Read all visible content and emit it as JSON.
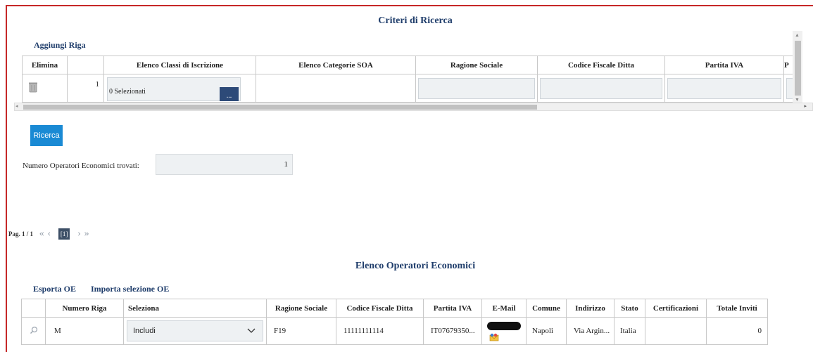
{
  "criteria": {
    "title": "Criteri di Ricerca",
    "add_row": "Aggiungi Riga",
    "columns": [
      "Elimina",
      "",
      "Elenco Classi di Iscrizione",
      "Elenco Categorie SOA",
      "Ragione Sociale",
      "Codice Fiscale Ditta",
      "Partita IVA",
      "P"
    ],
    "row": {
      "number": "1",
      "classi_value": "0 Selezionati",
      "picker_label": "..."
    }
  },
  "search": {
    "button": "Ricerca",
    "found_label": "Numero Operatori Economici trovati:",
    "found_value": "1"
  },
  "pager": {
    "label": "Pag. 1 / 1",
    "first": "«",
    "prev": "‹",
    "current": "[1]",
    "next": "›",
    "last": "»"
  },
  "results": {
    "title": "Elenco Operatori Economici",
    "export": "Esporta OE",
    "import": "Importa selezione OE",
    "columns": [
      "",
      "Numero Riga",
      "Seleziona",
      "Ragione Sociale",
      "Codice Fiscale Ditta",
      "Partita IVA",
      "E-Mail",
      "Comune",
      "Indirizzo",
      "Stato",
      "Certificazioni",
      "Totale Inviti"
    ],
    "row": {
      "numero": "M",
      "seleziona": "Includi",
      "ragione": "F19",
      "codice": "11111111114",
      "partita": "IT07679350...",
      "comune": "Napoli",
      "indirizzo": "Via Argin...",
      "stato": "Italia",
      "certificazioni": "",
      "totale": "0"
    }
  },
  "colors": {
    "accent": "#1a8ad4",
    "frame": "#c62828",
    "heading": "#1f3d6b"
  }
}
